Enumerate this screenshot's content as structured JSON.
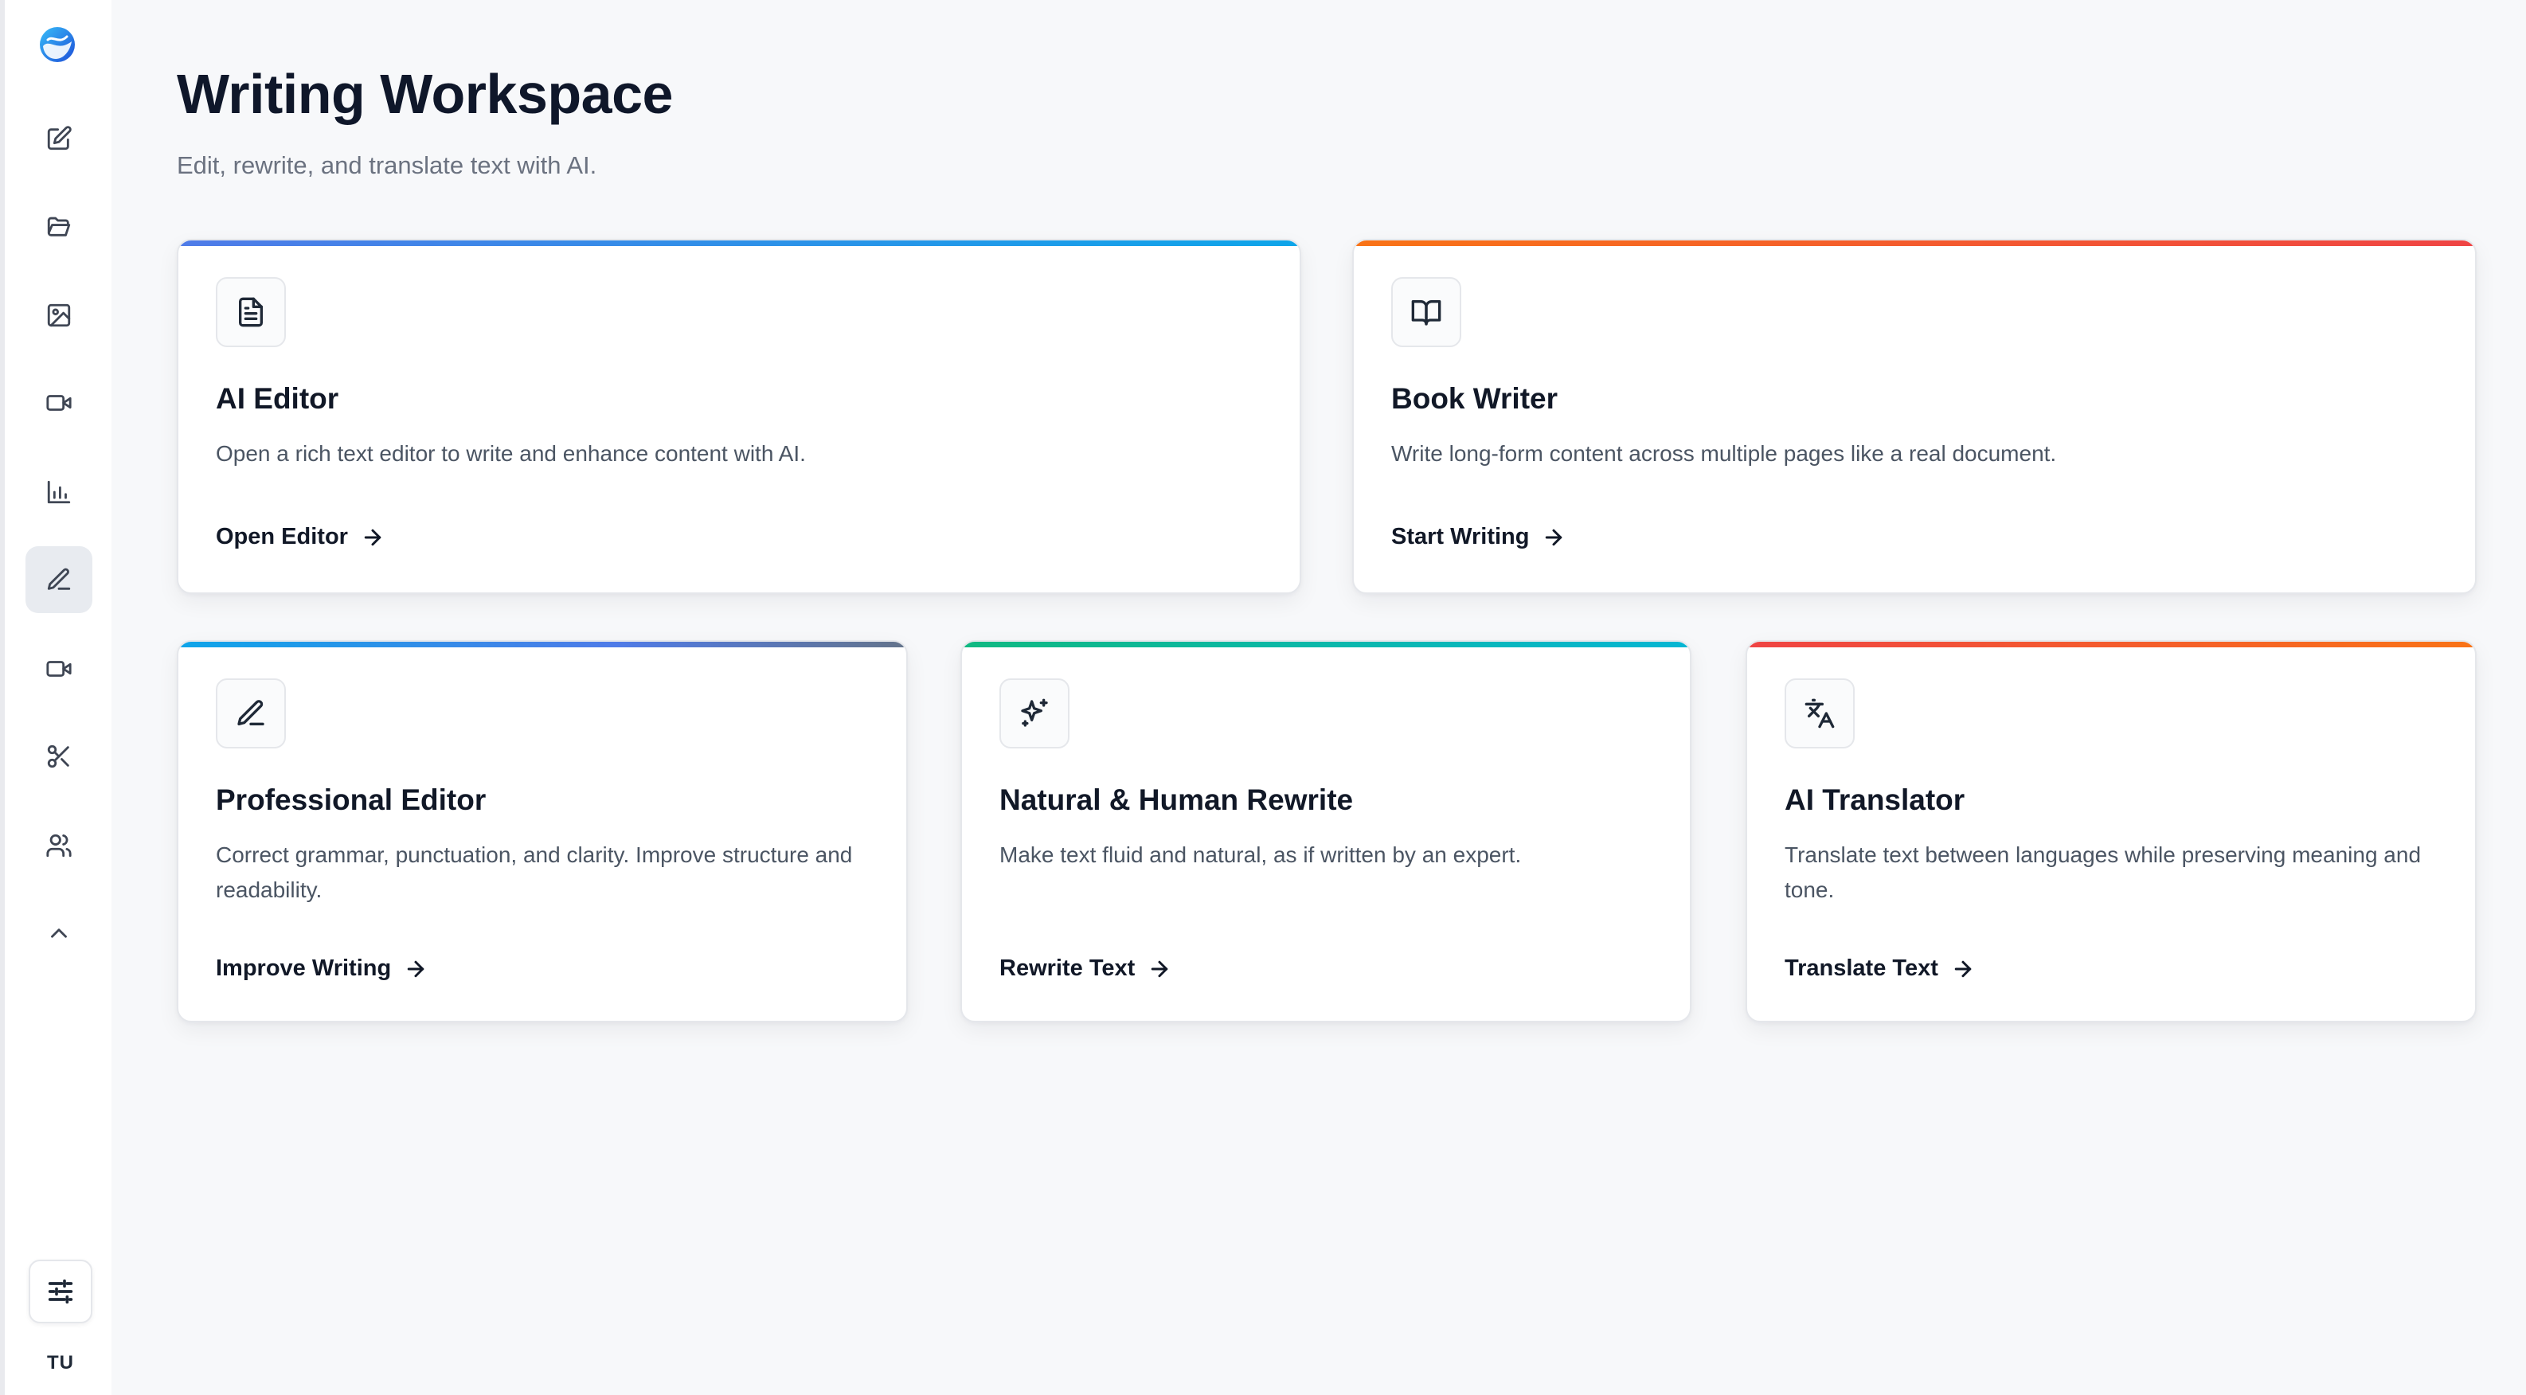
{
  "page": {
    "title": "Writing Workspace",
    "subtitle": "Edit, rewrite, and translate text with AI."
  },
  "sidebar": {
    "logo_icon": "wave-logo-icon",
    "items": [
      {
        "icon": "edit-square-icon",
        "active": false
      },
      {
        "icon": "folder-open-icon",
        "active": false
      },
      {
        "icon": "image-icon",
        "active": false
      },
      {
        "icon": "video-icon",
        "active": false
      },
      {
        "icon": "bar-chart-icon",
        "active": false
      },
      {
        "icon": "pencil-icon",
        "active": true
      },
      {
        "icon": "video-icon",
        "active": false
      },
      {
        "icon": "scissors-icon",
        "active": false
      },
      {
        "icon": "users-icon",
        "active": false
      },
      {
        "icon": "chevron-up-icon",
        "active": false
      }
    ],
    "settings_icon": "sliders-icon",
    "avatar_initials": "TU"
  },
  "cards": [
    {
      "icon": "document-icon",
      "title": "AI Editor",
      "description": "Open a rich text editor to write and enhance content with AI.",
      "link": "Open Editor",
      "accent": [
        "#4f7be8",
        "#0ea5e9"
      ]
    },
    {
      "icon": "book-open-icon",
      "title": "Book Writer",
      "description": "Write long-form content across multiple pages like a real document.",
      "link": "Start Writing",
      "accent": [
        "#f97316",
        "#ef4444"
      ]
    },
    {
      "icon": "pen-icon",
      "title": "Professional Editor",
      "description": "Correct grammar, punctuation, and clarity. Improve structure and readability.",
      "link": "Improve Writing",
      "accent": [
        "#0ea5e9",
        "#64748b"
      ]
    },
    {
      "icon": "sparkles-icon",
      "title": "Natural & Human Rewrite",
      "description": "Make text fluid and natural, as if written by an expert.",
      "link": "Rewrite Text",
      "accent": [
        "#10b981",
        "#06b6d4"
      ]
    },
    {
      "icon": "translate-icon",
      "title": "AI Translator",
      "description": "Translate text between languages while preserving meaning and tone.",
      "link": "Translate Text",
      "accent": [
        "#ef4444",
        "#f97316"
      ]
    }
  ]
}
